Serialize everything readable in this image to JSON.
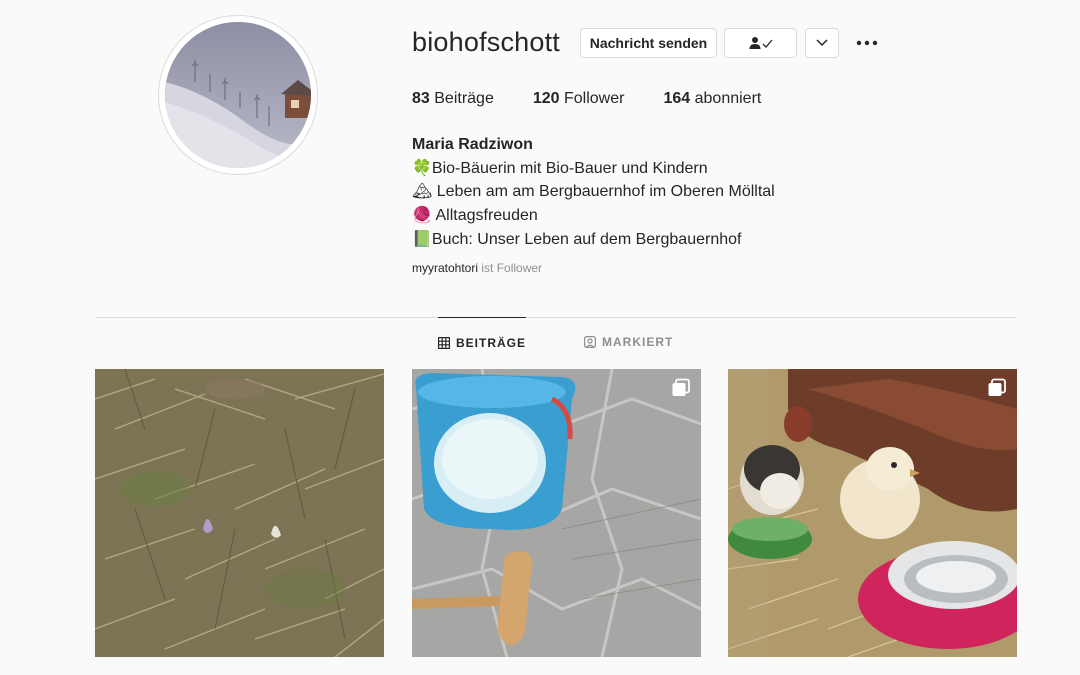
{
  "profile": {
    "username": "biohofschott",
    "message_button": "Nachricht senden",
    "stats": {
      "posts_count": "83",
      "posts_label": "Beiträge",
      "followers_count": "120",
      "followers_label": "Follower",
      "following_count": "164",
      "following_label": "abonniert"
    },
    "full_name": "Maria Radziwon",
    "bio_lines": [
      "🍀Bio-Bäuerin mit Bio-Bauer und Kindern",
      "🏔 Leben am am Bergbauernhof im Oberen Mölltal",
      "🧶 Alltagsfreuden",
      "📗Buch: Unser Leben auf dem Bergbauernhof"
    ],
    "followed_by_account": "myyratohtori",
    "followed_by_suffix": "ist Follower"
  },
  "tabs": [
    {
      "label": "BEITRÄGE",
      "icon": "grid-icon",
      "active": true
    },
    {
      "label": "MARKIERT",
      "icon": "tag-person-icon",
      "active": false
    }
  ],
  "posts": [
    {
      "description_icon": "photo",
      "multi": false
    },
    {
      "description_icon": "photo",
      "multi": true
    },
    {
      "description_icon": "photo",
      "multi": true
    }
  ],
  "colors": {
    "background": "#fafafa",
    "border": "#dbdbdb",
    "text": "#262626",
    "muted": "#8e8e8e"
  }
}
